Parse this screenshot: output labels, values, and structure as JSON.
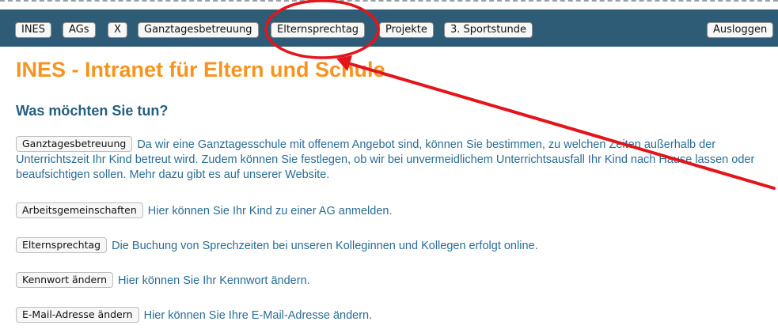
{
  "nav": {
    "items": [
      "INES",
      "AGs",
      "X",
      "Ganztagesbetreuung",
      "Elternsprechtag",
      "Projekte",
      "3. Sportstunde"
    ],
    "logout": "Ausloggen"
  },
  "title": "INES - Intranet für Eltern und Schule",
  "subtitle": "Was möchten Sie tun?",
  "actions": [
    {
      "button": "Ganztagesbetreuung",
      "text": "Da wir eine Ganztagesschule mit offenem Angebot sind, können Sie bestimmen, zu welchen Zeiten außerhalb der Unterrichtszeit Ihr Kind betreut wird. Zudem können Sie festlegen, ob wir bei unvermeidlichem Unterrichtsausfall Ihr Kind nach Hause lassen oder beaufsichtigen sollen. Mehr dazu gibt es auf unserer Website."
    },
    {
      "button": "Arbeitsgemeinschaften",
      "text": "Hier können Sie Ihr Kind zu einer AG anmelden."
    },
    {
      "button": "Elternsprechtag",
      "text": "Die Buchung von Sprechzeiten bei unseren Kolleginnen und Kollegen erfolgt online."
    },
    {
      "button": "Kennwort ändern",
      "text": "Hier können Sie Ihr Kennwort ändern."
    },
    {
      "button": "E-Mail-Adresse ändern",
      "text": "Hier können Sie Ihre E-Mail-Adresse ändern."
    }
  ],
  "colors": {
    "navbar": "#2e5c77",
    "title": "#f7941d",
    "subtitle": "#245e80",
    "body_text": "#2a6c93",
    "annotation": "#e3151b"
  }
}
